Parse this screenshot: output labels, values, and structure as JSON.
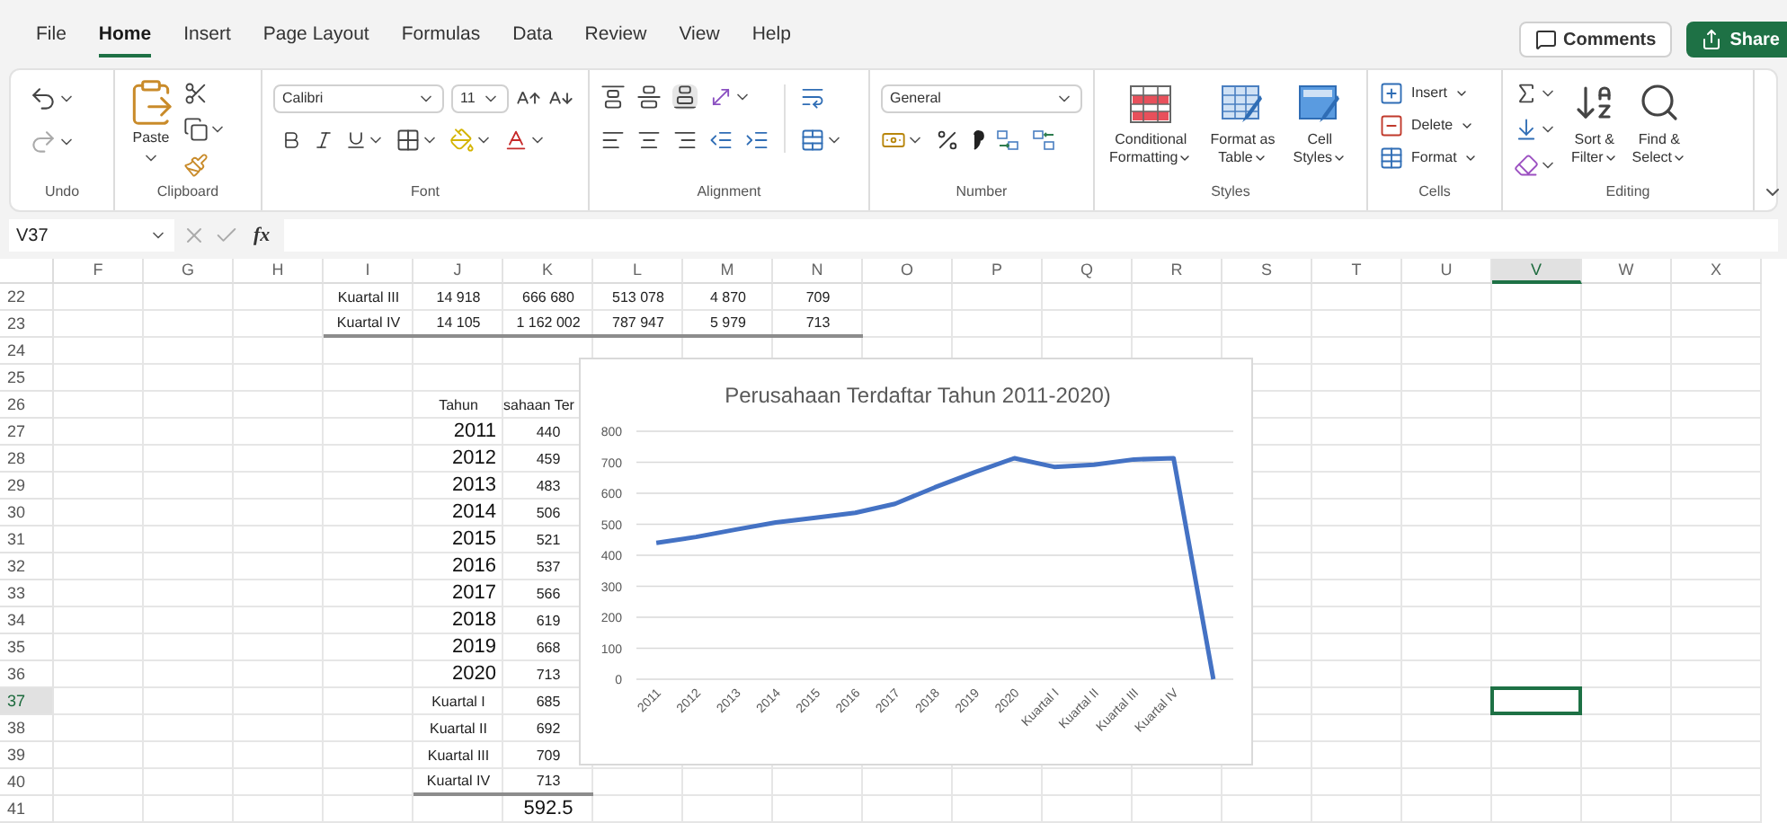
{
  "menu_tabs": [
    {
      "label": "File",
      "selected": false
    },
    {
      "label": "Home",
      "selected": true
    },
    {
      "label": "Insert",
      "selected": false
    },
    {
      "label": "Page Layout",
      "selected": false
    },
    {
      "label": "Formulas",
      "selected": false
    },
    {
      "label": "Data",
      "selected": false
    },
    {
      "label": "Review",
      "selected": false
    },
    {
      "label": "View",
      "selected": false
    },
    {
      "label": "Help",
      "selected": false
    }
  ],
  "header_buttons": {
    "comments": "Comments",
    "share": "Share"
  },
  "ribbon": {
    "undo": {
      "label": "Undo"
    },
    "clipboard": {
      "label": "Clipboard",
      "paste": "Paste"
    },
    "font": {
      "label": "Font",
      "name": "Calibri",
      "size": "11"
    },
    "alignment": {
      "label": "Alignment"
    },
    "number": {
      "label": "Number",
      "format": "General"
    },
    "styles": {
      "label": "Styles",
      "buttons": [
        {
          "kind": "conditional",
          "top": "Conditional",
          "bottom": "Formatting"
        },
        {
          "kind": "table",
          "top": "Format as",
          "bottom": "Table"
        },
        {
          "kind": "cell",
          "top": "Cell",
          "bottom": "Styles"
        }
      ]
    },
    "cells": {
      "label": "Cells",
      "buttons": [
        {
          "kind": "insert",
          "label": "Insert"
        },
        {
          "kind": "delete",
          "label": "Delete"
        },
        {
          "kind": "format",
          "label": "Format"
        }
      ]
    },
    "editing": {
      "label": "Editing",
      "buttons": [
        {
          "kind": "sort",
          "top": "Sort &",
          "bottom": "Filter"
        },
        {
          "kind": "find",
          "top": "Find &",
          "bottom": "Select"
        }
      ]
    }
  },
  "formula_bar": {
    "cell_ref": "V37",
    "fx": "fx"
  },
  "sheet": {
    "columns": [
      {
        "label": "F",
        "selected": false
      },
      {
        "label": "G",
        "selected": false
      },
      {
        "label": "H",
        "selected": false
      },
      {
        "label": "I",
        "selected": false
      },
      {
        "label": "J",
        "selected": false
      },
      {
        "label": "K",
        "selected": false
      },
      {
        "label": "L",
        "selected": false
      },
      {
        "label": "M",
        "selected": false
      },
      {
        "label": "N",
        "selected": false
      },
      {
        "label": "O",
        "selected": false
      },
      {
        "label": "P",
        "selected": false
      },
      {
        "label": "Q",
        "selected": false
      },
      {
        "label": "R",
        "selected": false
      },
      {
        "label": "S",
        "selected": false
      },
      {
        "label": "T",
        "selected": false
      },
      {
        "label": "U",
        "selected": false
      },
      {
        "label": "V",
        "selected": true
      },
      {
        "label": "W",
        "selected": false
      },
      {
        "label": "X",
        "selected": false
      }
    ],
    "rows": [
      {
        "number": "22",
        "selected": false
      },
      {
        "number": "23",
        "selected": false
      },
      {
        "number": "24",
        "selected": false
      },
      {
        "number": "25",
        "selected": false
      },
      {
        "number": "26",
        "selected": false
      },
      {
        "number": "27",
        "selected": false
      },
      {
        "number": "28",
        "selected": false
      },
      {
        "number": "29",
        "selected": false
      },
      {
        "number": "30",
        "selected": false
      },
      {
        "number": "31",
        "selected": false
      },
      {
        "number": "32",
        "selected": false
      },
      {
        "number": "33",
        "selected": false
      },
      {
        "number": "34",
        "selected": false
      },
      {
        "number": "35",
        "selected": false
      },
      {
        "number": "36",
        "selected": false
      },
      {
        "number": "37",
        "selected": true
      },
      {
        "number": "38",
        "selected": false
      },
      {
        "number": "39",
        "selected": false
      },
      {
        "number": "40",
        "selected": false
      },
      {
        "number": "41",
        "selected": false
      }
    ],
    "quarter_table": [
      {
        "label": "Kuartal III",
        "values": [
          "14 918",
          "666 680",
          "513 078",
          "4 870",
          "709"
        ]
      },
      {
        "label": "Kuartal IV",
        "values": [
          "14 105",
          "1 162 002",
          "787 947",
          "5 979",
          "713"
        ]
      }
    ],
    "year_table": {
      "headers": [
        "Tahun",
        "sahaan Ter"
      ],
      "rows": [
        {
          "kind": "year",
          "label": "2011",
          "value": "440"
        },
        {
          "kind": "year",
          "label": "2012",
          "value": "459"
        },
        {
          "kind": "year",
          "label": "2013",
          "value": "483"
        },
        {
          "kind": "year",
          "label": "2014",
          "value": "506"
        },
        {
          "kind": "year",
          "label": "2015",
          "value": "521"
        },
        {
          "kind": "year",
          "label": "2016",
          "value": "537"
        },
        {
          "kind": "year",
          "label": "2017",
          "value": "566"
        },
        {
          "kind": "year",
          "label": "2018",
          "value": "619"
        },
        {
          "kind": "year",
          "label": "2019",
          "value": "668"
        },
        {
          "kind": "year",
          "label": "2020",
          "value": "713"
        },
        {
          "kind": "quarter",
          "label": "Kuartal I",
          "value": "685"
        },
        {
          "kind": "quarter",
          "label": "Kuartal II",
          "value": "692"
        },
        {
          "kind": "quarter",
          "label": "Kuartal III",
          "value": "709"
        },
        {
          "kind": "quarter",
          "label": "Kuartal IV",
          "value": "713"
        }
      ],
      "total": "592.5"
    },
    "chart": {
      "chart_data": {
        "type": "line",
        "title": "Perusahaan Terdaftar Tahun 2011-2020)",
        "categories": [
          "2011",
          "2012",
          "2013",
          "2014",
          "2015",
          "2016",
          "2017",
          "2018",
          "2019",
          "2020",
          "Kuartal I",
          "Kuartal II",
          "Kuartal III",
          "Kuartal IV",
          null
        ],
        "series": [
          {
            "color": "#4472c4",
            "values": [
              440,
              459,
              483,
              506,
              521,
              537,
              566,
              619,
              668,
              713,
              685,
              692,
              709,
              713,
              0
            ]
          }
        ],
        "grid": true,
        "ylim": [
          0,
          800
        ],
        "yticks": [
          0,
          100,
          200,
          300,
          400,
          500,
          600,
          700,
          800
        ]
      }
    }
  }
}
